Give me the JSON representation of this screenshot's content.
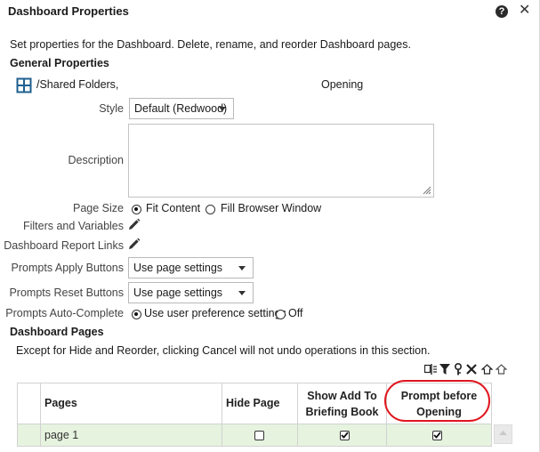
{
  "dialog": {
    "title": "Dashboard Properties",
    "help_glyph": "?",
    "close_glyph": "✕"
  },
  "intro": "Set properties for the Dashboard. Delete, rename, and reorder Dashboard pages.",
  "general": {
    "heading": "General Properties",
    "path": "/Shared Folders,",
    "path_tail": "Opening",
    "style_label": "Style",
    "style_value": "Default (Redwood)",
    "description_label": "Description",
    "description_value": "",
    "page_size_label": "Page Size",
    "page_size_options": [
      "Fit Content",
      "Fill Browser Window"
    ],
    "page_size_selected": "Fit Content",
    "filters_label": "Filters and Variables",
    "report_links_label": "Dashboard Report Links",
    "apply_buttons_label": "Prompts Apply Buttons",
    "apply_buttons_value": "Use page settings",
    "reset_buttons_label": "Prompts Reset Buttons",
    "reset_buttons_value": "Use page settings",
    "auto_complete_label": "Prompts Auto-Complete",
    "auto_complete_options": [
      "Use user preference settings",
      "Off"
    ],
    "auto_complete_selected": "Use user preference settings"
  },
  "pages_section": {
    "heading": "Dashboard Pages",
    "note": "Except for Hide and Reorder, clicking Cancel will not undo operations in this section.",
    "toolbar_icons": [
      "rename-icon",
      "filter-icon",
      "permissions-icon",
      "delete-icon",
      "move-up-icon",
      "move-down-icon"
    ],
    "columns": {
      "pages": "Pages",
      "hide_page": "Hide Page",
      "show_add_line1": "Show Add To",
      "show_add_line2": "Briefing Book",
      "prompt_line1": "Prompt before",
      "prompt_line2": "Opening"
    },
    "rows": [
      {
        "name": "page 1",
        "hide_page": false,
        "show_add_to_briefing_book": true,
        "prompt_before_opening": true
      }
    ]
  },
  "colors": {
    "row_highlight": "#e6f3df",
    "annotation_circle": "#e1151e",
    "grid_icon": "#1f5f8f"
  }
}
